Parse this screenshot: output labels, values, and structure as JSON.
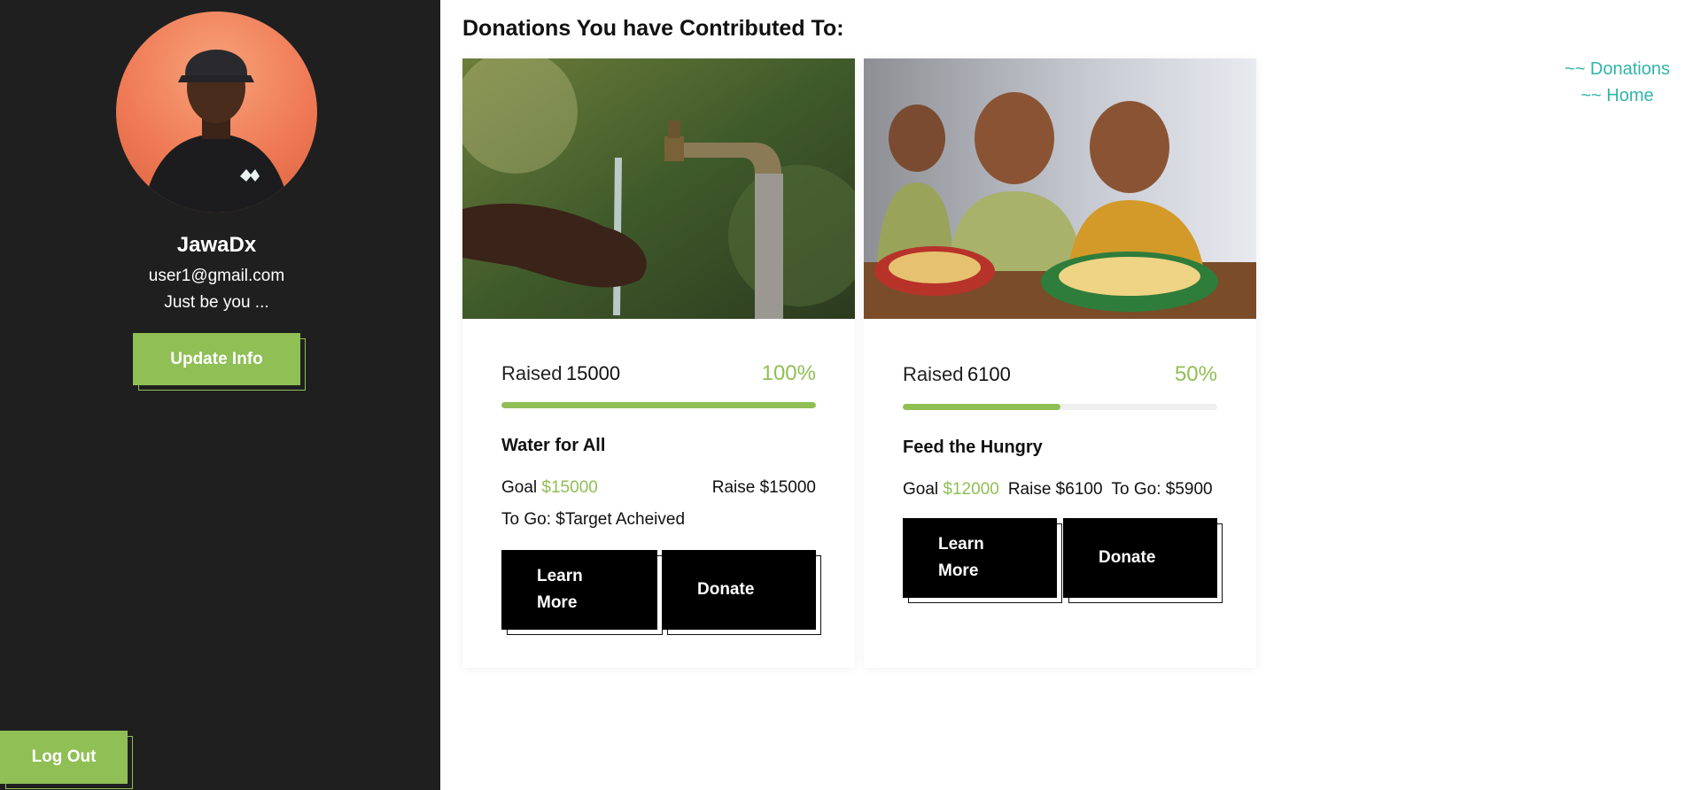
{
  "sidebar": {
    "user_name": "JawaDx",
    "email": "user1@gmail.com",
    "bio": "Just be you ...",
    "update_label": "Update Info",
    "logout_label": "Log Out",
    "avatar_icon": "person-avatar"
  },
  "page": {
    "heading": "Donations You have Contributed To:"
  },
  "nav": {
    "donations": "~~ Donations",
    "home": "~~ Home"
  },
  "colors": {
    "accent_green": "#8fbf55",
    "link_teal": "#2fb5a8",
    "sidebar_bg": "#1f1f1f"
  },
  "cards": [
    {
      "image_icon": "water-tap-image",
      "raised_label": "Raised",
      "raised_value": "15000",
      "percent": "100%",
      "progress": 1.0,
      "title": "Water for All",
      "goal_label": "Goal",
      "goal_value": "$15000",
      "raise_text": "Raise $15000",
      "togo_text": "To Go: $Target Acheived",
      "learn_more": "Learn More",
      "donate": "Donate"
    },
    {
      "image_icon": "children-eating-image",
      "raised_label": "Raised",
      "raised_value": "6100",
      "percent": "50%",
      "progress": 0.5,
      "title": "Feed the Hungry",
      "goal_label": "Goal",
      "goal_value": "$12000",
      "raise_text": "Raise $6100",
      "togo_text": "To Go: $5900",
      "learn_more": "Learn More",
      "donate": "Donate"
    }
  ]
}
